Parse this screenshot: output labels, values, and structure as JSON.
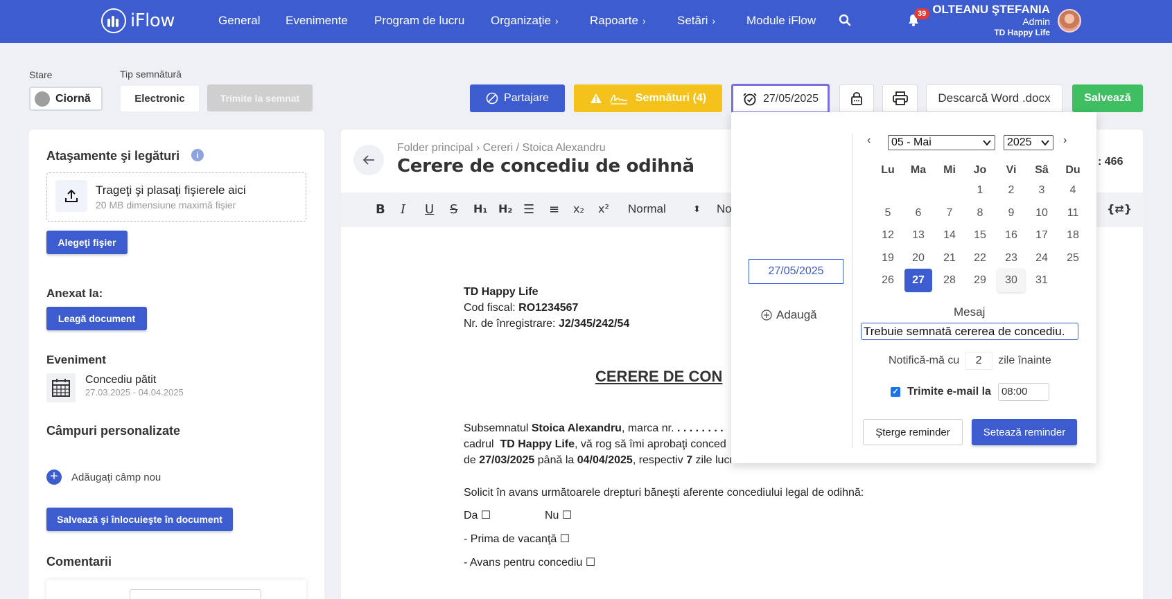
{
  "topnav": {
    "logo": "iFlow",
    "items": [
      "General",
      "Evenimente",
      "Program de lucru",
      "Organizaţie",
      "Rapoarte",
      "Setări",
      "Module iFlow"
    ],
    "notifications_count": "39",
    "user_name": "OLTEANU ŞTEFANIA",
    "user_role": "Admin",
    "user_company": "TD Happy Life"
  },
  "toolbar": {
    "stare_label": "Stare",
    "stare_value": "Ciornă",
    "tip_label": "Tip semnătură",
    "tip_value": "Electronic",
    "send_sign": "Trimite la semnat",
    "share": "Partajare",
    "signatures": "Semnături (4)",
    "reminder_date": "27/05/2025",
    "download_word": "Descarcă Word .docx",
    "save": "Salvează"
  },
  "left": {
    "attachments_title": "Ataşamente şi legături",
    "drop_title": "Trageţi şi plasaţi fişierele aici",
    "drop_sub": "20 MB dimensiune maximă fişier",
    "choose_file": "Alegeţi fişier",
    "annex_title": "Anexat la:",
    "link_doc": "Leagă document",
    "event_title": "Eveniment",
    "event_name": "Concediu pătit",
    "event_dates": "27.03.2025 - 04.04.2025",
    "custom_title": "Câmpuri personalizate",
    "add_field": "Adăugaţi câmp nou",
    "save_replace": "Salvează şi înlocuieşte în document",
    "comments_title": "Comentarii"
  },
  "doc": {
    "breadcrumb_root": "Folder principal",
    "breadcrumb_path": "Cereri / Stoica Alexandru",
    "title": "Cerere de concediu de odihnă",
    "right_counter_suffix": ": 466",
    "format_select": "Normal",
    "font_select_partial": "No",
    "company": "TD Happy Life",
    "fiscal_label": "Cod fiscal:",
    "fiscal_value": "RO1234567",
    "reg_label": "Nr. de înregistrare:",
    "reg_value": "J2/345/242/54",
    "heading_partial": "CERERE DE CON",
    "p1_a": "Subsemnatul",
    "p1_name": "Stoica Alexandru",
    "p1_b": ", marca nr.",
    "p1_dots": ". . . . . . . .",
    "p2_a": "cadrul",
    "p2_company": "TD Happy Life",
    "p2_b": ", vă rog să îmi aprobaţi conced",
    "p3_a": "de",
    "p3_from": "27/03/2025",
    "p3_b": "până la",
    "p3_to": "04/04/2025",
    "p3_c": ", respectiv",
    "p3_days": "7",
    "p3_d": "zile lucrătoare.",
    "p4": "Solicit în avans următoarele drepturi băneşti aferente concediului legal de odihnă:",
    "da": "Da ☐",
    "nu": "Nu ☐",
    "prima": "- Prima de vacanţă ☐",
    "avans": "- Avans pentru concediu  ☐"
  },
  "reminder": {
    "date_value": "27/05/2025",
    "add": "Adaugă",
    "month_select": "05 - Mai",
    "year_select": "2025",
    "weekdays": [
      "Lu",
      "Ma",
      "Mi",
      "Jo",
      "Vi",
      "Sâ",
      "Du"
    ],
    "days": [
      "1",
      "2",
      "3",
      "4",
      "5",
      "6",
      "7",
      "8",
      "9",
      "10",
      "11",
      "12",
      "13",
      "14",
      "15",
      "16",
      "17",
      "18",
      "19",
      "20",
      "21",
      "22",
      "23",
      "24",
      "25",
      "26",
      "27",
      "28",
      "29",
      "30",
      "31"
    ],
    "selected_day": "27",
    "message_label": "Mesaj",
    "message_value": "Trebuie semnată cererea de concediu.",
    "notify_a": "Notifică-mă cu",
    "notify_days": "2",
    "notify_b": "zile înainte",
    "email_label": "Trimite e-mail la",
    "email_time": "08:00",
    "delete_btn": "Şterge reminder",
    "set_btn": "Setează reminder"
  },
  "colors": {
    "primary": "#3c5ccf",
    "yellow": "#f5c21b",
    "green": "#3fbf62",
    "badge": "#e53935"
  }
}
